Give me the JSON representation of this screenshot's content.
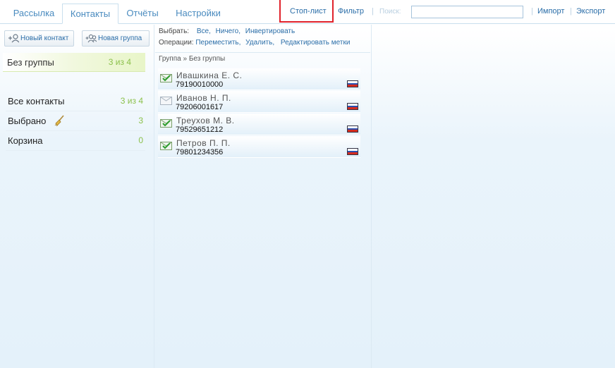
{
  "tabs": [
    {
      "label": "Рассылка",
      "active": false
    },
    {
      "label": "Контакты",
      "active": true
    },
    {
      "label": "Отчёты",
      "active": false
    },
    {
      "label": "Настройки",
      "active": false
    }
  ],
  "toolbar": {
    "stoplist": "Стоп-лист",
    "filter": "Фильтр",
    "search_label": "Поиск:",
    "search_value": "",
    "sep": "|",
    "import": "Импорт",
    "export": "Экспорт"
  },
  "sidebar": {
    "new_contact": "Новый контакт",
    "new_group": "Новая группа",
    "group": {
      "name": "Без группы",
      "count": "3 из 4"
    },
    "items": [
      {
        "name": "Все контакты",
        "count": "3 из 4"
      },
      {
        "name": "Выбрано",
        "count": "3"
      },
      {
        "name": "Корзина",
        "count": "0"
      }
    ]
  },
  "ops": {
    "select_label": "Выбрать:",
    "select_all": "Все,",
    "select_none": "Ничего,",
    "select_invert": "Инвертировать",
    "ops_label": "Операции:",
    "op_move": "Переместить,",
    "op_delete": "Удалить,",
    "op_edit_tags": "Редактировать метки"
  },
  "breadcrumb": "Группа » Без группы",
  "contacts": [
    {
      "name": "Ивашкина Е. С.",
      "phone": "79190010000",
      "checked": true
    },
    {
      "name": "Иванов Н. П.",
      "phone": "79206001617",
      "checked": false
    },
    {
      "name": "Треухов М. В.",
      "phone": "79529651212",
      "checked": true
    },
    {
      "name": "Петров П. П.",
      "phone": "79801234356",
      "checked": true
    }
  ],
  "colors": {
    "link": "#2b6ea8",
    "tab": "#4a8bbf",
    "count_green": "#8cc14c",
    "highlight_red": "#e0222b",
    "flag": [
      "#ffffff",
      "#2a4fb0",
      "#d52b1e"
    ]
  },
  "icons": [
    "add-contact-icon",
    "add-group-icon",
    "broom-icon",
    "envelope-check-icon",
    "envelope-icon",
    "russia-flag-icon"
  ]
}
